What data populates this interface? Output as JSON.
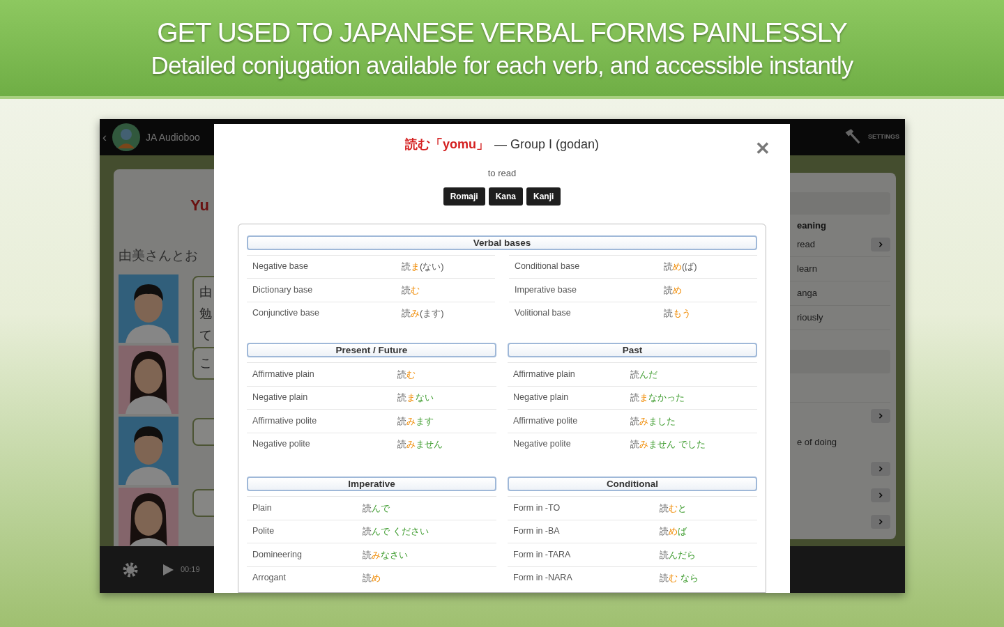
{
  "banner": {
    "headline": "GET USED TO JAPANESE VERBAL FORMS PAINLESSLY",
    "subtitle": "Detailed conjugation available for each verb, and accessible instantly"
  },
  "app_header": {
    "back": "‹",
    "title": "JA Audioboo",
    "settings": "SETTINGS"
  },
  "lesson": {
    "title": "Yu",
    "intro": "由美さんとお",
    "dialogue": [
      {
        "kind": "male",
        "lines": [
          "由",
          "勉",
          "て"
        ]
      },
      {
        "kind": "female",
        "lines": [
          "こ"
        ]
      },
      {
        "kind": "male"
      },
      {
        "kind": "female"
      }
    ]
  },
  "player": {
    "time": "00:19"
  },
  "side_menu": {
    "heading": "eaning",
    "items": [
      {
        "label": "read",
        "arrow": true
      },
      {
        "label": "learn",
        "arrow": false
      },
      {
        "label": "anga",
        "arrow": false
      },
      {
        "label": "riously",
        "arrow": false
      }
    ],
    "items_2": [
      {
        "arrow": true
      },
      {
        "label": "e of doing",
        "arrow": false
      },
      {
        "arrow": true
      },
      {
        "arrow": true
      },
      {
        "arrow": true
      }
    ]
  },
  "verb_dialog": {
    "verb": "読む「yomu」",
    "group": "— Group I (godan)",
    "close": "✕",
    "meaning": "to read",
    "script_buttons": [
      "Romaji",
      "Kana",
      "Kanji"
    ],
    "sections": [
      {
        "kind": "wide",
        "title": "Verbal bases",
        "columns": [
          [
            {
              "label": "Negative base",
              "value": [
                {
                  "kind": "root",
                  "text": "読"
                },
                {
                  "kind": "base",
                  "text": "ま"
                },
                {
                  "kind": "aux",
                  "text": "(ない)"
                }
              ]
            },
            {
              "label": "Dictionary base",
              "value": [
                {
                  "kind": "root",
                  "text": "読"
                },
                {
                  "kind": "base",
                  "text": "む"
                }
              ]
            },
            {
              "label": "Conjunctive base",
              "value": [
                {
                  "kind": "root",
                  "text": "読"
                },
                {
                  "kind": "base",
                  "text": "み"
                },
                {
                  "kind": "aux",
                  "text": "(ます)"
                }
              ]
            }
          ],
          [
            {
              "label": "Conditional base",
              "value": [
                {
                  "kind": "root",
                  "text": "読"
                },
                {
                  "kind": "base",
                  "text": "め"
                },
                {
                  "kind": "aux",
                  "text": "(ば)"
                }
              ]
            },
            {
              "label": "Imperative base",
              "value": [
                {
                  "kind": "root",
                  "text": "読"
                },
                {
                  "kind": "base",
                  "text": "め"
                }
              ]
            },
            {
              "label": "Volitional base",
              "value": [
                {
                  "kind": "root",
                  "text": "読"
                },
                {
                  "kind": "base",
                  "text": "もう"
                }
              ]
            }
          ]
        ]
      },
      {
        "kind": "half",
        "title": "Present / Future",
        "columns": [
          [
            {
              "label": "Affirmative plain",
              "value": [
                {
                  "kind": "root",
                  "text": "読"
                },
                {
                  "kind": "base",
                  "text": "む"
                }
              ]
            },
            {
              "label": "Negative plain",
              "value": [
                {
                  "kind": "root",
                  "text": "読"
                },
                {
                  "kind": "base",
                  "text": "ま"
                },
                {
                  "kind": "ending",
                  "text": "ない"
                }
              ]
            },
            {
              "label": "Affirmative polite",
              "value": [
                {
                  "kind": "root",
                  "text": "読"
                },
                {
                  "kind": "base",
                  "text": "み"
                },
                {
                  "kind": "ending",
                  "text": "ます"
                }
              ]
            },
            {
              "label": "Negative polite",
              "value": [
                {
                  "kind": "root",
                  "text": "読"
                },
                {
                  "kind": "base",
                  "text": "み"
                },
                {
                  "kind": "ending",
                  "text": "ません"
                }
              ]
            }
          ]
        ]
      },
      {
        "kind": "half",
        "title": "Past",
        "columns": [
          [
            {
              "label": "Affirmative plain",
              "value": [
                {
                  "kind": "root",
                  "text": "読"
                },
                {
                  "kind": "ending",
                  "text": "んだ"
                }
              ]
            },
            {
              "label": "Negative plain",
              "value": [
                {
                  "kind": "root",
                  "text": "読"
                },
                {
                  "kind": "base",
                  "text": "ま"
                },
                {
                  "kind": "ending",
                  "text": "なかった"
                }
              ]
            },
            {
              "label": "Affirmative polite",
              "value": [
                {
                  "kind": "root",
                  "text": "読"
                },
                {
                  "kind": "base",
                  "text": "み"
                },
                {
                  "kind": "ending",
                  "text": "ました"
                }
              ]
            },
            {
              "label": "Negative polite",
              "value": [
                {
                  "kind": "root",
                  "text": "読"
                },
                {
                  "kind": "base",
                  "text": "み"
                },
                {
                  "kind": "ending",
                  "text": "ません でした"
                }
              ]
            }
          ]
        ]
      },
      {
        "kind": "half",
        "title": "Imperative",
        "columns": [
          [
            {
              "label": "Plain",
              "value": [
                {
                  "kind": "root",
                  "text": "読"
                },
                {
                  "kind": "ending",
                  "text": "んで"
                }
              ]
            },
            {
              "label": "Polite",
              "value": [
                {
                  "kind": "root",
                  "text": "読"
                },
                {
                  "kind": "ending",
                  "text": "んで ください"
                }
              ]
            },
            {
              "label": "Domineering",
              "value": [
                {
                  "kind": "root",
                  "text": "読"
                },
                {
                  "kind": "base",
                  "text": "み"
                },
                {
                  "kind": "ending",
                  "text": "なさい"
                }
              ]
            },
            {
              "label": "Arrogant",
              "value": [
                {
                  "kind": "root",
                  "text": "読"
                },
                {
                  "kind": "base",
                  "text": "め"
                }
              ]
            }
          ]
        ]
      },
      {
        "kind": "half",
        "title": "Conditional",
        "columns": [
          [
            {
              "label": "Form in -TO",
              "value": [
                {
                  "kind": "root",
                  "text": "読"
                },
                {
                  "kind": "base",
                  "text": "む"
                },
                {
                  "kind": "ending",
                  "text": "と"
                }
              ]
            },
            {
              "label": "Form in -BA",
              "value": [
                {
                  "kind": "root",
                  "text": "読"
                },
                {
                  "kind": "base",
                  "text": "め"
                },
                {
                  "kind": "ending",
                  "text": "ば"
                }
              ]
            },
            {
              "label": "Form in -TARA",
              "value": [
                {
                  "kind": "root",
                  "text": "読"
                },
                {
                  "kind": "ending",
                  "text": "んだら"
                }
              ]
            },
            {
              "label": "Form in -NARA",
              "value": [
                {
                  "kind": "root",
                  "text": "読"
                },
                {
                  "kind": "base",
                  "text": "む"
                },
                {
                  "kind": "ending",
                  "text": " なら"
                }
              ]
            }
          ]
        ]
      }
    ]
  }
}
